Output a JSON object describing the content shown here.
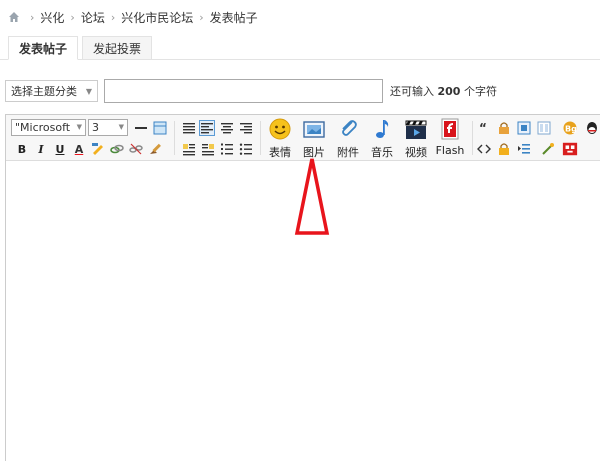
{
  "breadcrumb": {
    "items": [
      "兴化",
      "论坛",
      "兴化市民论坛",
      "发表帖子"
    ],
    "separator": "›"
  },
  "tabs": [
    {
      "label": "发表帖子",
      "active": true
    },
    {
      "label": "发起投票",
      "active": false
    }
  ],
  "subject": {
    "type_select": "选择主题分类",
    "input_value": "",
    "hint_prefix": "还可输入",
    "hint_count": "200",
    "hint_suffix": "个字符"
  },
  "toolbar": {
    "font_family": "\"Microsoft",
    "font_size": "3",
    "format_buttons": [
      "B",
      "I",
      "U",
      "A"
    ],
    "insert_buttons": [
      {
        "label": "表情",
        "icon": "smiley-icon"
      },
      {
        "label": "图片",
        "icon": "image-icon"
      },
      {
        "label": "附件",
        "icon": "paperclip-icon"
      },
      {
        "label": "音乐",
        "icon": "music-note-icon"
      },
      {
        "label": "视频",
        "icon": "clapperboard-icon"
      },
      {
        "label": "Flash",
        "icon": "flash-icon"
      }
    ]
  },
  "colors": {
    "accent_red": "#e8141c",
    "border": "#cccccc",
    "toolbar_bg": "#f7f7f7"
  }
}
